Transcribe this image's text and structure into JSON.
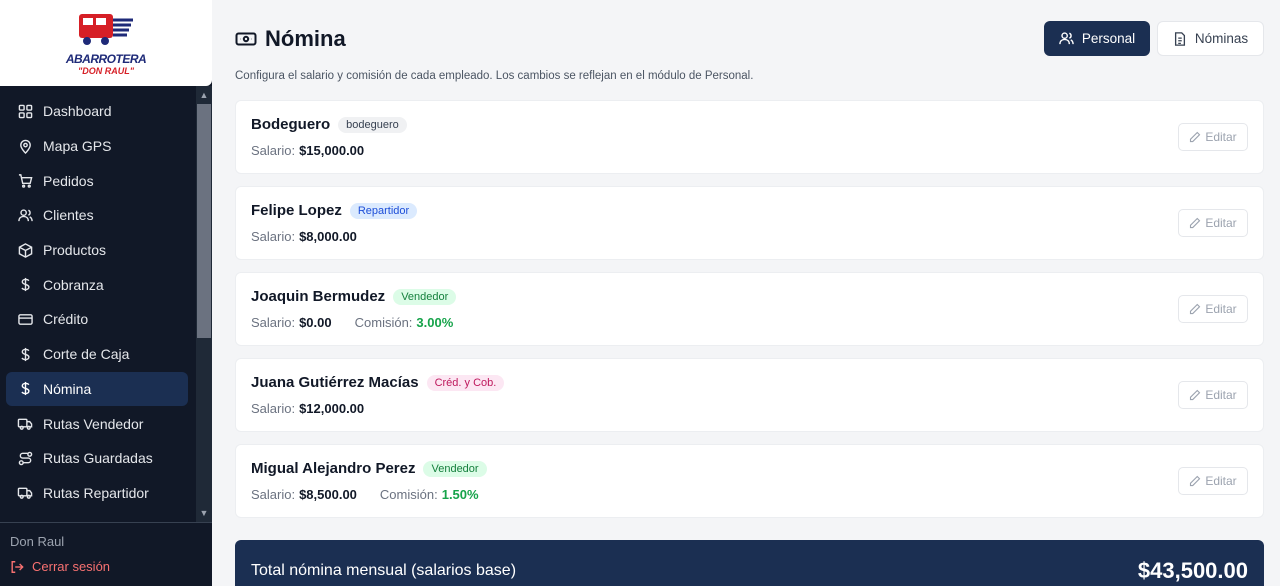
{
  "brand": {
    "name": "ABARROTERA",
    "sub": "\"DON RAUL\"",
    "colors": {
      "navy": "#1e2a78",
      "red": "#d61f26"
    }
  },
  "sidebar": {
    "items": [
      {
        "label": "Dashboard",
        "icon": "grid-icon"
      },
      {
        "label": "Mapa GPS",
        "icon": "map-pin-icon"
      },
      {
        "label": "Pedidos",
        "icon": "cart-icon"
      },
      {
        "label": "Clientes",
        "icon": "users-icon"
      },
      {
        "label": "Productos",
        "icon": "box-icon"
      },
      {
        "label": "Cobranza",
        "icon": "dollar-icon"
      },
      {
        "label": "Crédito",
        "icon": "credit-card-icon"
      },
      {
        "label": "Corte de Caja",
        "icon": "dollar-icon"
      },
      {
        "label": "Nómina",
        "icon": "dollar-icon",
        "active": true
      },
      {
        "label": "Rutas Vendedor",
        "icon": "truck-icon"
      },
      {
        "label": "Rutas Guardadas",
        "icon": "route-icon"
      },
      {
        "label": "Rutas Repartidor",
        "icon": "truck-icon"
      }
    ],
    "user_name": "Don Raul",
    "logout_label": "Cerrar sesión"
  },
  "header": {
    "title": "Nómina",
    "subtitle": "Configura el salario y comisión de cada empleado. Los cambios se reflejan en el módulo de Personal.",
    "tabs": {
      "personal": "Personal",
      "nominas": "Nóminas"
    }
  },
  "labels": {
    "salary": "Salario:",
    "commission": "Comisión:",
    "edit": "Editar"
  },
  "employees": [
    {
      "name": "Bodeguero",
      "role": "bodeguero",
      "role_color": "gray",
      "salary": "$15,000.00"
    },
    {
      "name": "Felipe Lopez",
      "role": "Repartidor",
      "role_color": "blue",
      "salary": "$8,000.00"
    },
    {
      "name": "Joaquin Bermudez",
      "role": "Vendedor",
      "role_color": "green",
      "salary": "$0.00",
      "commission": "3.00%"
    },
    {
      "name": "Juana Gutiérrez Macías",
      "role": "Créd. y Cob.",
      "role_color": "pink",
      "salary": "$12,000.00"
    },
    {
      "name": "Migual Alejandro Perez",
      "role": "Vendedor",
      "role_color": "green",
      "salary": "$8,500.00",
      "commission": "1.50%"
    }
  ],
  "total": {
    "label": "Total nómina mensual (salarios base)",
    "value": "$43,500.00"
  }
}
